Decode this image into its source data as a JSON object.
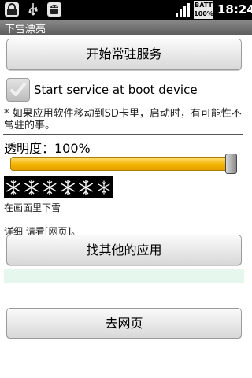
{
  "status_bar": {
    "time": "18:24",
    "battery_line1": "BATT",
    "battery_line2": "100%",
    "icons": [
      "lock-icon",
      "usb-icon",
      "android-icon",
      "signal-icon",
      "battery-icon"
    ]
  },
  "app": {
    "title": "下雪漂亮"
  },
  "buttons": {
    "start_service": "开始常驻服务",
    "find_more_apps": "找其他的应用",
    "go_webpage": "去网页"
  },
  "boot_option": {
    "label": "Start service at boot device",
    "checked": true
  },
  "note": "* 如果应用软件移动到SD卡里，启动时，有可能性不常驻的事。",
  "opacity": {
    "label": "透明度：100%",
    "value": 1.0
  },
  "snow_caption": "在画面里下雪",
  "detail_text": "详细 请看[网页]。",
  "colors": {
    "slider_fill": "#f3b400",
    "title_bar": "#6e6e6e",
    "green_bar": "#e6f8ee"
  }
}
